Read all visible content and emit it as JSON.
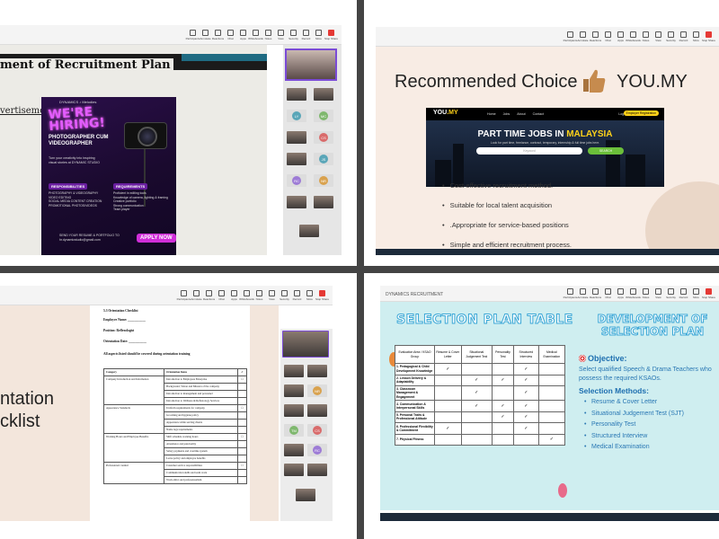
{
  "toolbar": {
    "items": [
      "Participants",
      "Annotate",
      "Reactions",
      "Chat",
      "Apps",
      "Whiteboards",
      "Notes",
      "View",
      "Security",
      "Record",
      "More",
      "Stop Share"
    ],
    "stop_label": "Stop Share"
  },
  "q1": {
    "title": "ment of Recruitment Plan",
    "subtitle": "vertisement",
    "poster": {
      "brand": "DYNAMICS ♪ Melodies",
      "were": "WE'RE",
      "hiring": "HIRING!",
      "job1": "PHOTOGRAPHER CUM",
      "job2": "VIDEOGRAPHER",
      "desc": "Turn your creativity into inspiring visual stories at DYNAMIC STUDIO",
      "resp_head": "RESPONSIBILITIES",
      "resp": [
        "PHOTOGRAPHY & VIDEOGRAPHY",
        "VIDEO EDITING",
        "SOCIAL MEDIA CONTENT CREATION",
        "PROMOTIONAL PHOTOS/VIDEOS"
      ],
      "req_head": "REQUIREMENTS",
      "req": [
        "Proficient in editing tools",
        "Knowledge of camera, lighting & framing",
        "Creative portfolio",
        "Strong communication",
        "Team player"
      ],
      "send": "SEND YOUR RESUME & PORTFOLIO TO",
      "email": "hr.dynamicstudio@gmail.com",
      "apply": "APPLY NOW"
    },
    "avatars": [
      {
        "initials": "LY",
        "color": "#5aa6b8"
      },
      {
        "initials": "MC",
        "color": "#7fb86e"
      },
      {
        "initials": "CS",
        "color": "#d96b6b"
      },
      {
        "initials": "JS",
        "color": "#5aa6b8"
      },
      {
        "initials": "RC",
        "color": "#9d7bd6"
      },
      {
        "initials": "NR",
        "color": "#d9a24e"
      }
    ]
  },
  "q2": {
    "title": "Recommended Choice",
    "brand": "YOU.MY",
    "site_logo_a": "YOU",
    "site_logo_b": ".MY",
    "nav": [
      "Home",
      "Jobs",
      "About",
      "Contact"
    ],
    "login": "Login",
    "register": "Employer Registration",
    "hero_a": "PART TIME JOBS IN ",
    "hero_b": "MALAYSIA",
    "hero_sub": "Look for part time, freelance, contract, temporary, internship & full time jobs here.",
    "search_placeholder": "Keyword",
    "search_btn": "SEARCH",
    "bullets": [
      "Cost-effective recruitment method.",
      "Suitable for local talent acquisition",
      ".Appropriate for service-based positions",
      "Simple and efficient recruitment process."
    ]
  },
  "q3": {
    "big1": "ntation",
    "big2": "cklist",
    "doc_title": "5.3 Orientation Checklist",
    "employee": "Employee Name: ___________",
    "position": "Position: Reflexologist",
    "date": "Orientation Date: ___________",
    "intro": "All aspects listed should be covered during orientation training",
    "col_category": "Category",
    "col_item": "Orientation Items",
    "col_check": "✓",
    "rows": [
      {
        "category": "Company Introduction and Information",
        "items": [
          "Introduction to Employees Enterprise",
          "Background, Vision and Mission of the company",
          "Introduction to management and personnel",
          "Introduction to Wellness & Reflexology Services"
        ]
      },
      {
        "category": "Appearance Standards",
        "items": [
          "Uniform requirements for company",
          "Grooming and hygiene policy",
          "Appearance while serving clients",
          "Name tags requirements"
        ]
      },
      {
        "category": "Working Hours and Employee Benefits",
        "items": [
          "Shift schedule working hours",
          "Attendance and punctuality",
          "Salary payments and overtime system",
          "Leave policy and employee benefits"
        ]
      },
      {
        "category": "Professional conduct",
        "items": [
          "Customer service responsibilities",
          "Communication skills and team work",
          "Work ethics and professionalism"
        ]
      }
    ],
    "avatars": [
      {
        "initials": "NR",
        "color": "#d9a24e"
      },
      {
        "initials": "TM",
        "color": "#7fb86e"
      },
      {
        "initials": "CS",
        "color": "#d96b6b"
      },
      {
        "initials": "RC",
        "color": "#9d7bd6"
      }
    ]
  },
  "q4": {
    "window_title": "DYNAMICS RECRUITMENT",
    "title1": "SELECTION PLAN TABLE",
    "title2a": "DEVELOPMENT OF",
    "title2b": "SELECTION PLAN",
    "table_headers": [
      "Evaluation Area / KSAO Group",
      "Resume & Cover Letter",
      "Situational Judgement Test",
      "Personality Test",
      "Structured Interview",
      "Medical Examination"
    ],
    "table_rows": [
      {
        "area": "1. Pedagogical & Child Development Knowledge",
        "marks": [
          "✓",
          "",
          "",
          "✓",
          ""
        ]
      },
      {
        "area": "2. Lesson Delivery & Adaptability",
        "marks": [
          "",
          "✓",
          "✓",
          "✓",
          ""
        ]
      },
      {
        "area": "3. Classroom Management & Engagement",
        "marks": [
          "",
          "✓",
          "",
          "✓",
          ""
        ]
      },
      {
        "area": "4. Communication & Interpersonal Skills",
        "marks": [
          "",
          "✓",
          "✓",
          "✓",
          ""
        ]
      },
      {
        "area": "5. Personal Traits & Professional Attitude",
        "marks": [
          "",
          "",
          "✓",
          "✓",
          ""
        ]
      },
      {
        "area": "6. Professional Flexibility & Commitment",
        "marks": [
          "✓",
          "",
          "",
          "✓",
          ""
        ]
      },
      {
        "area": "7. Physical Fitness",
        "marks": [
          "",
          "",
          "",
          "",
          "✓"
        ]
      }
    ],
    "objective_head": "Objective:",
    "objective": "Select qualified Speech & Drama Teachers who possess the required KSAOs.",
    "methods_head": "Selection Methods:",
    "methods": [
      "Resume & Cover Letter",
      "Situational Judgement Test (SJT)",
      "Personality Test",
      "Structured Interview",
      "Medical Examination"
    ]
  }
}
